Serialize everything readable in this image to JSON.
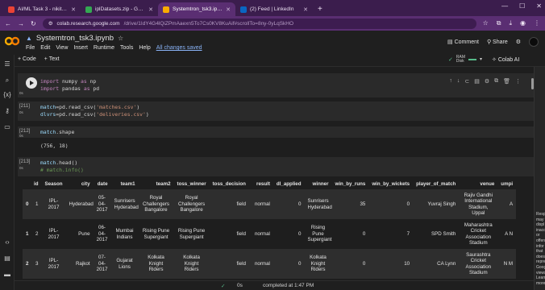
{
  "browser": {
    "tabs": [
      {
        "label": "AI/ML Task 3 - nikithan3@gmai",
        "fav_color": "#ea4335"
      },
      {
        "label": "iplDatasets.zip - Google Drive",
        "fav_color": "#34a853"
      },
      {
        "label": "Systemtron_tsk3.ipynb - Colab",
        "fav_color": "#f9ab00"
      },
      {
        "label": "(2) Feed | LinkedIn",
        "fav_color": "#0a66c2"
      }
    ],
    "new_tab": "+",
    "url_host": "colab.research.google.com",
    "url_path": "/drive/1IdY4G4lQiZPmAaexn5To7Cs0KV8KuAif#scrollTo=8ny-0yLqSkHO"
  },
  "colab": {
    "title": "Systemtron_tsk3.ipynb",
    "menu": [
      "File",
      "Edit",
      "View",
      "Insert",
      "Runtime",
      "Tools",
      "Help"
    ],
    "saved_status": "All changes saved",
    "comment_label": "Comment",
    "share_label": "Share",
    "toolbar": {
      "code": "+ Code",
      "text": "+ Text"
    },
    "ram_label": "RAM",
    "disk_label": "Disk",
    "colab_ai_label": "Colab AI"
  },
  "cells": [
    {
      "exec": "",
      "lines": [
        [
          {
            "c": "kw",
            "t": "import"
          },
          {
            "c": "plain",
            "t": " numpy "
          },
          {
            "c": "kw",
            "t": "as"
          },
          {
            "c": "plain",
            "t": " np"
          }
        ],
        [
          {
            "c": "kw",
            "t": "import"
          },
          {
            "c": "plain",
            "t": " pandas "
          },
          {
            "c": "kw",
            "t": "as"
          },
          {
            "c": "plain",
            "t": " pd"
          }
        ]
      ]
    },
    {
      "exec": "[211]",
      "lines": [
        [
          {
            "c": "var",
            "t": "match"
          },
          {
            "c": "plain",
            "t": "=pd.read_csv("
          },
          {
            "c": "str",
            "t": "'matches.csv'"
          },
          {
            "c": "plain",
            "t": ")"
          }
        ],
        [
          {
            "c": "var",
            "t": "dlvrs"
          },
          {
            "c": "plain",
            "t": "=pd.read_csv("
          },
          {
            "c": "str",
            "t": "'deliveries.csv'"
          },
          {
            "c": "plain",
            "t": ")"
          }
        ]
      ]
    },
    {
      "exec": "[212]",
      "lines": [
        [
          {
            "c": "var",
            "t": "match"
          },
          {
            "c": "plain",
            "t": ".shape"
          }
        ]
      ],
      "output": "(756, 18)"
    },
    {
      "exec": "[213]",
      "lines": [
        [
          {
            "c": "var",
            "t": "match"
          },
          {
            "c": "plain",
            "t": ".head()"
          }
        ],
        [
          {
            "c": "cmt",
            "t": "# match.info()"
          }
        ]
      ]
    }
  ],
  "exec_suffix": "0s",
  "table": {
    "columns": [
      "",
      "id",
      "Season",
      "city",
      "date",
      "team1",
      "team2",
      "toss_winner",
      "toss_decision",
      "result",
      "dl_applied",
      "winner",
      "win_by_runs",
      "win_by_wickets",
      "player_of_match",
      "venue",
      "umpi"
    ],
    "rows": [
      [
        "0",
        "1",
        "IPL-2017",
        "Hyderabad",
        "05-04-2017",
        "Sunrisers Hyderabad",
        "Royal Challengers Bangalore",
        "Royal Challengers Bangalore",
        "field",
        "normal",
        "0",
        "Sunrisers Hyderabad",
        "35",
        "0",
        "Yuvraj Singh",
        "Rajiv Gandhi International Stadium, Uppal",
        "A"
      ],
      [
        "1",
        "2",
        "IPL-2017",
        "Pune",
        "06-04-2017",
        "Mumbai Indians",
        "Rising Pune Supergiant",
        "Rising Pune Supergiant",
        "field",
        "normal",
        "0",
        "Rising Pune Supergiant",
        "0",
        "7",
        "SPD Smith",
        "Maharashtra Cricket Association Stadium",
        "A N"
      ],
      [
        "2",
        "3",
        "IPL-2017",
        "Rajkot",
        "07-04-2017",
        "Gujarat Lions",
        "Kolkata Knight Riders",
        "Kolkata Knight Riders",
        "field",
        "normal",
        "0",
        "Kolkata Knight Riders",
        "0",
        "10",
        "CA Lynn",
        "Saurashtra Cricket Association Stadium",
        "N M"
      ]
    ]
  },
  "right_panel": {
    "text": "Resp\nmay \ndispl\ninacc\nor\noffen\ninfor\nthat \ndoesn\nrepre\nGoog\nviews\nLearn\nmore"
  },
  "status": {
    "check": "✓",
    "elapsed": "0s",
    "completed": "completed at 1:47 PM"
  }
}
